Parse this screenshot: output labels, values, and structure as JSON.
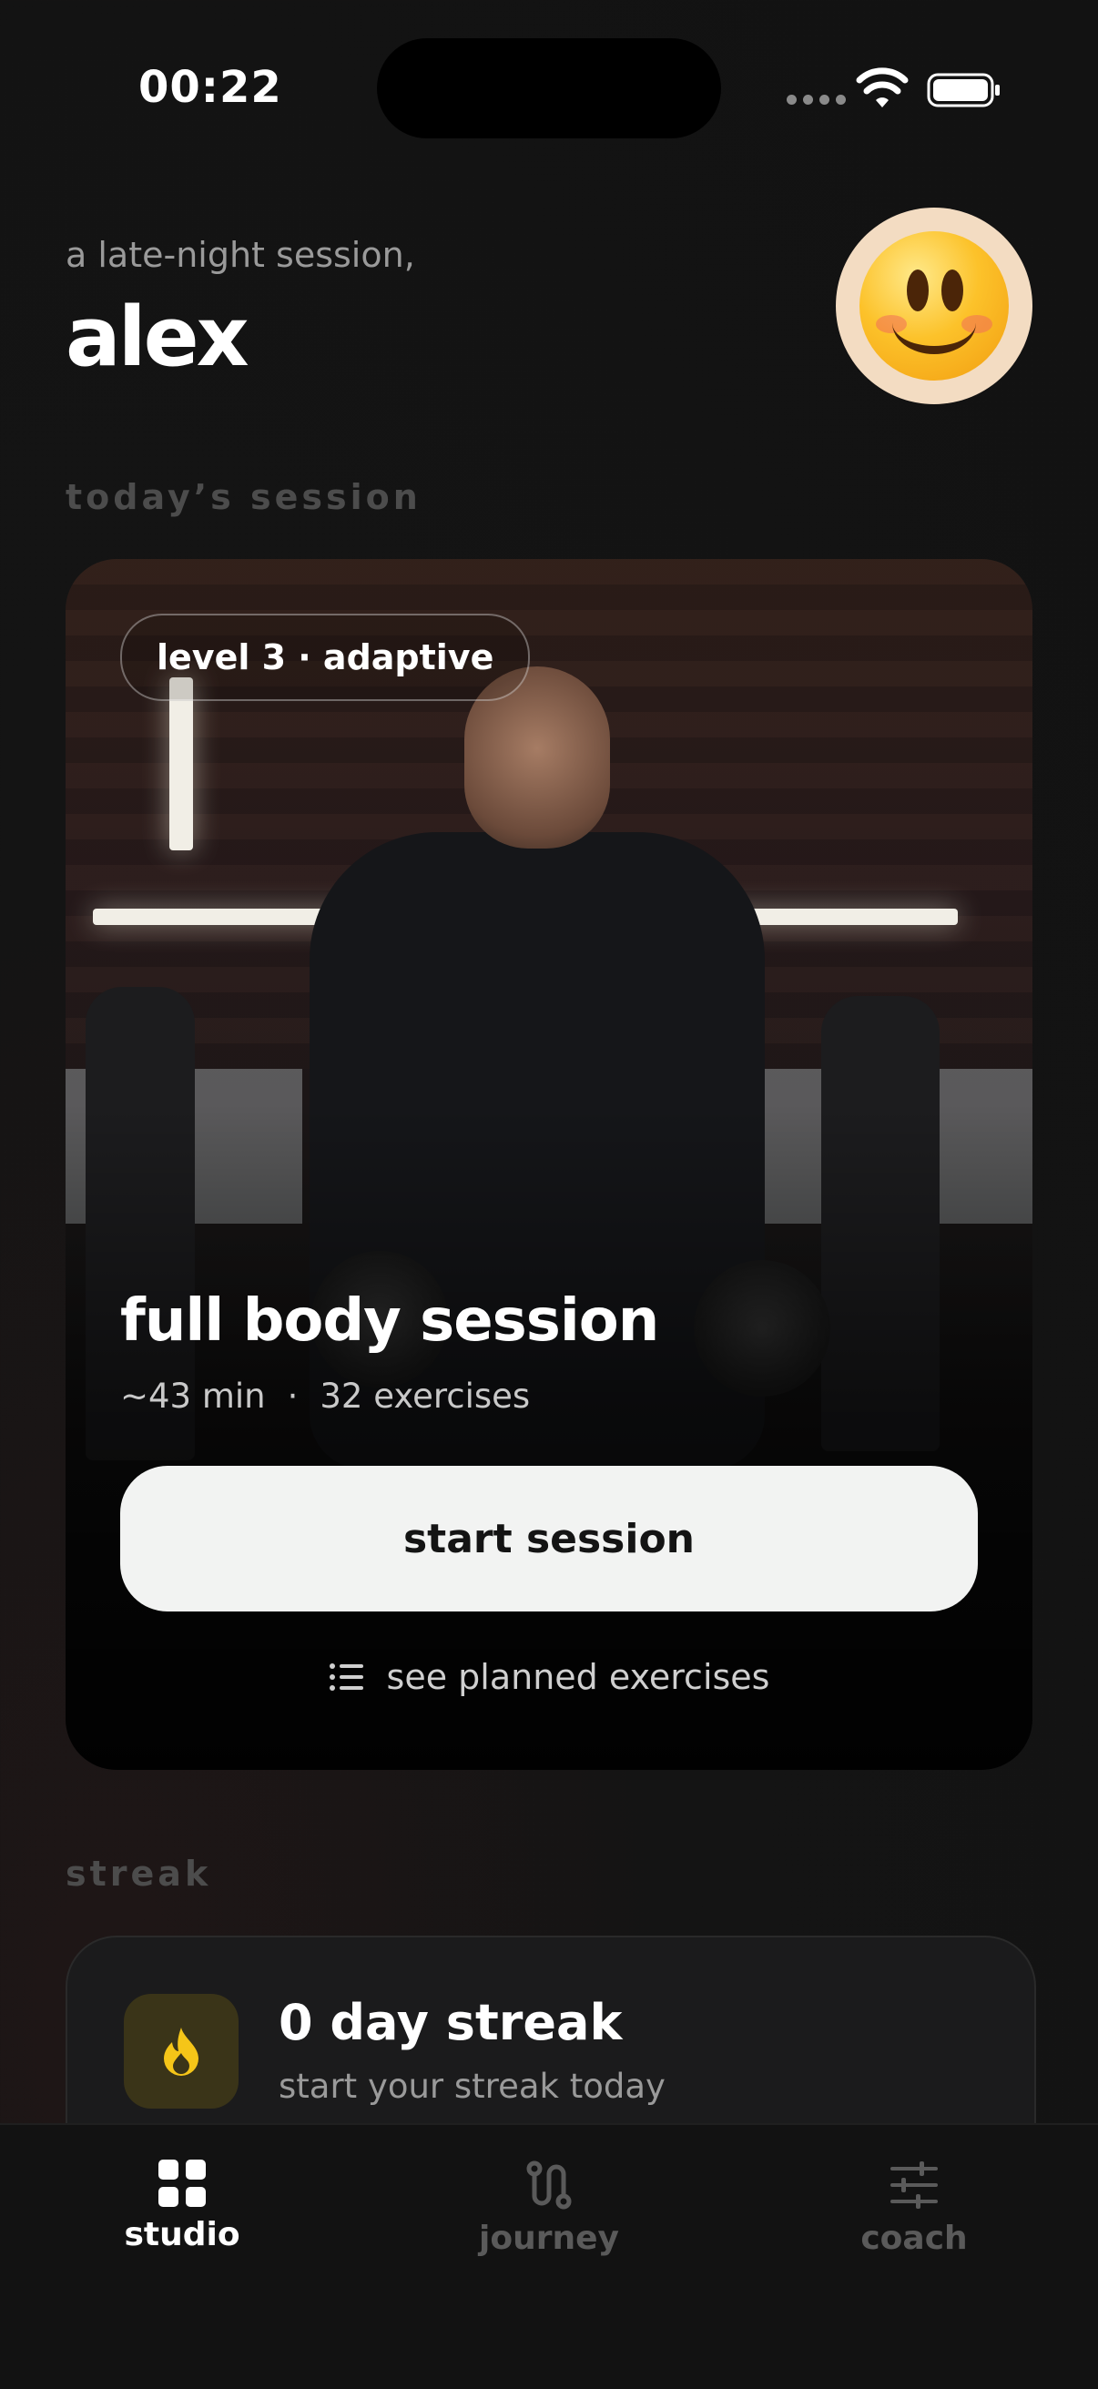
{
  "status_bar": {
    "time": "00:22"
  },
  "header": {
    "greeting": "a late-night session,",
    "name": "alex"
  },
  "sections": {
    "today": "today’s session",
    "streak": "streak"
  },
  "session_card": {
    "level_badge": "level 3 · adaptive",
    "title": "full body session",
    "duration": "~43 min",
    "separator": "·",
    "exercises": "32 exercises",
    "start_label": "start session",
    "planned_label": "see planned exercises"
  },
  "streak_card": {
    "title": "0 day streak",
    "subtitle": "start your streak today",
    "icon": "flame-icon",
    "icon_color": "#f5c518"
  },
  "tabs": [
    {
      "label": "studio",
      "icon": "grid-icon",
      "active": true
    },
    {
      "label": "journey",
      "icon": "route-icon",
      "active": false
    },
    {
      "label": "coach",
      "icon": "sliders-icon",
      "active": false
    }
  ]
}
